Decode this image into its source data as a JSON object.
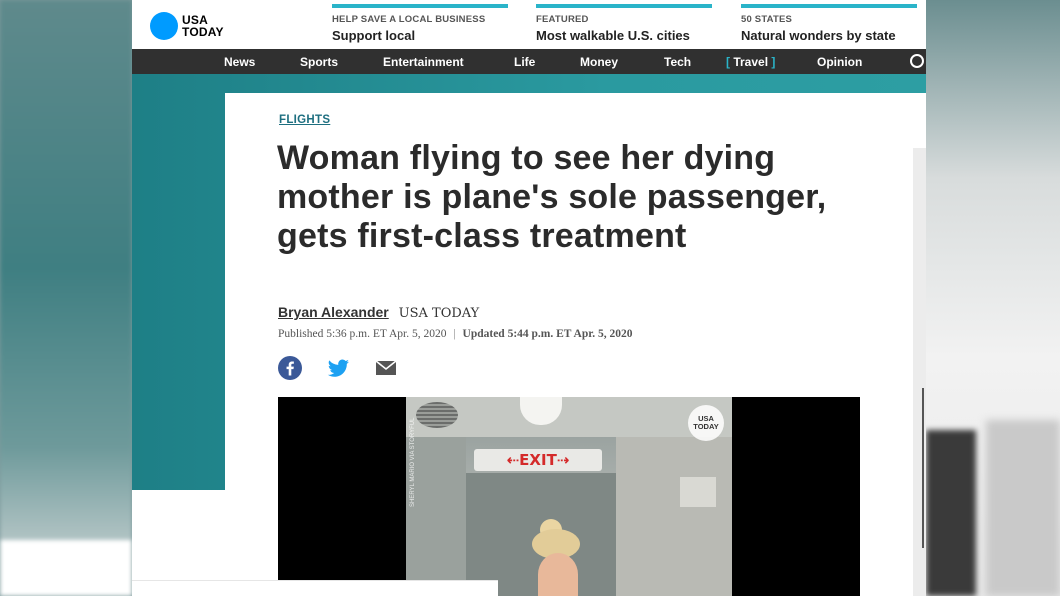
{
  "header": {
    "logo_text_line1": "USA",
    "logo_text_line2": "TODAY",
    "promos": [
      {
        "kicker": "HELP SAVE A LOCAL BUSINESS",
        "title": "Support local"
      },
      {
        "kicker": "FEATURED",
        "title": "Most walkable U.S. cities"
      },
      {
        "kicker": "50 STATES",
        "title": "Natural wonders by state"
      }
    ]
  },
  "nav": {
    "items": [
      "News",
      "Sports",
      "Entertainment",
      "Life",
      "Money",
      "Tech",
      "Travel",
      "Opinion"
    ],
    "active": "Travel",
    "active_open_bracket": "[",
    "active_close_bracket": "]"
  },
  "article": {
    "section": "FLIGHTS",
    "headline": "Woman flying to see her dying mother is plane's sole passenger, gets first-class treatment",
    "author": "Bryan Alexander",
    "outlet": "USA TODAY",
    "published": "Published 5:36 p.m. ET Apr. 5, 2020",
    "separator": "|",
    "updated": "Updated 5:44 p.m. ET Apr. 5, 2020"
  },
  "share": {
    "icons": [
      "facebook-icon",
      "twitter-icon",
      "email-icon"
    ],
    "colors": {
      "facebook": "#3b5998",
      "twitter": "#1da1f2",
      "email": "#555555"
    }
  },
  "video": {
    "exit_sign": "⇠EXIT⇢",
    "watermark_line1": "USA",
    "watermark_line2": "TODAY",
    "credit": "SHERYL MARIO VIA STORYFUL"
  },
  "colors": {
    "accent_teal": "#2ab4c9",
    "logo_blue": "#009bff",
    "navbar": "#303030",
    "section_label": "#1e6f80"
  }
}
